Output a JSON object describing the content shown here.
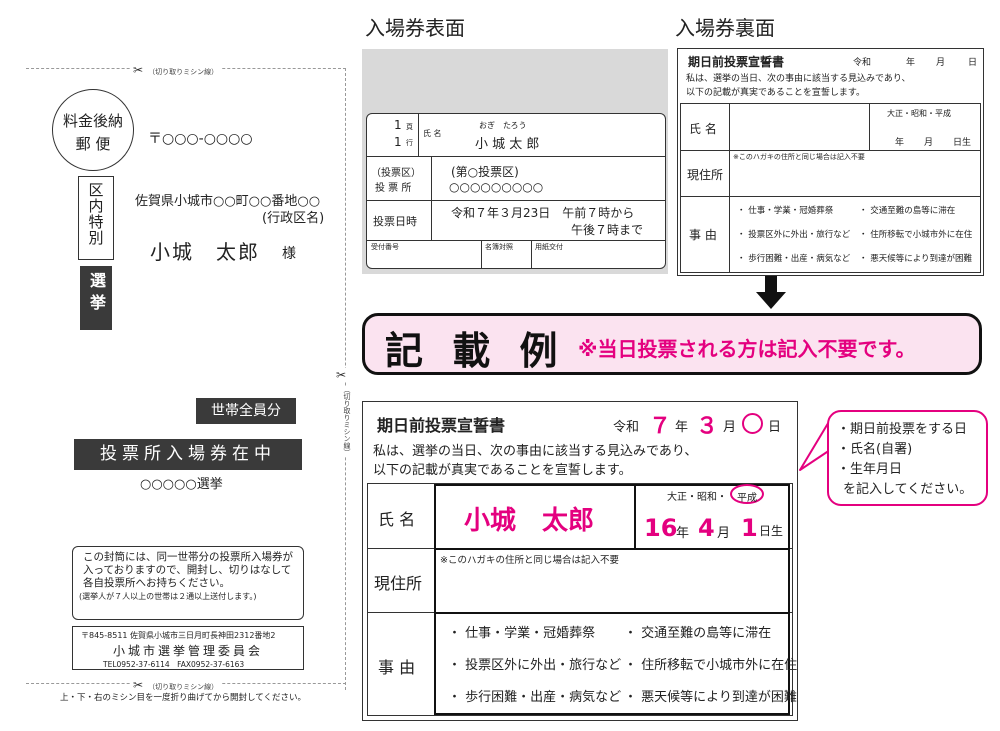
{
  "envelope": {
    "cut_line_label": "（切り取りミシン線）",
    "postage_line1": "料金後納",
    "postage_line2": "郵 便",
    "zip_code": "〒○○○-○○○○",
    "district_mark": "区内特別",
    "election_mark": "選挙",
    "address_line1": "佐賀県小城市○○町○○番地○○",
    "address_line2": "(行政区名)",
    "recipient_name": "小城　太郎",
    "honorific": "様",
    "household_label": "世帯全員分",
    "ticket_enclosed": "投票所入場券在中",
    "election_name": "○○○○○選挙",
    "notice_text": "この封筒には、同一世帯分の投票所入場券が入っておりますので、開封し、切りはなして各自投票所へお持ちください。",
    "notice_note": "(選挙人が７人以上の世帯は２通以上送付します。)",
    "sender_address": "〒845-8511 佐賀県小城市三日月町長神田2312番地2",
    "sender_name": "小城市選挙管理委員会",
    "sender_phone": "TEL0952-37-6114　FAX0952-37-6163",
    "bottom_instruction": "上・下・右のミシン目を一度折り曲げてから開封してください。"
  },
  "front": {
    "heading": "入場券表面",
    "page_num": "1",
    "page_label": "頁",
    "line_num": "1",
    "line_label": "行",
    "name_label": "氏 名",
    "furigana": "おぎ　たろう",
    "name": "小 城 太 郎",
    "district_label": "（投票区）",
    "place_label": "投 票 所",
    "district_value": "(第○投票区)",
    "place_value": "○○○○○○○○○",
    "date_label": "投票日時",
    "date_value": "令和７年３月23日　午前７時から",
    "time_value": "午後７時まで",
    "footer_col1": "受付番号",
    "footer_col2": "名簿対照",
    "footer_col3": "用紙交付"
  },
  "back": {
    "heading": "入場券裏面",
    "title": "期日前投票宣誓書",
    "era": "令和",
    "year_label": "年",
    "month_label": "月",
    "day_label": "日",
    "intro_line1": "私は、選挙の当日、次の事由に該当する見込みであり、",
    "intro_line2": "以下の記載が真実であることを宣誓します。",
    "name_label": "氏 名",
    "eras": "大正・昭和・平成",
    "birth_year": "年",
    "birth_month": "月",
    "birth_day": "日生",
    "address_label": "現住所",
    "address_note": "※このハガキの住所と同じ場合は記入不要",
    "reason_label": "事 由",
    "reasons": [
      "・ 仕事・学業・冠婚葬祭",
      "・ 交通至難の島等に滞在",
      "・ 投票区外に外出・旅行など",
      "・ 住所移転で小城市外に在住",
      "・ 歩行困難・出産・病気など",
      "・ 悪天候等により到達が困難"
    ]
  },
  "example": {
    "banner_title": "記 載 例",
    "banner_note": "※当日投票される方は記入不要です。",
    "title": "期日前投票宣誓書",
    "era": "令和",
    "year_value": "７",
    "year_label": "年",
    "month_value": "３",
    "month_label": "月",
    "day_label": "日",
    "intro_line1": "私は、選挙の当日、次の事由に該当する見込みであり、",
    "intro_line2": "以下の記載が真実であることを宣誓します。",
    "name_label": "氏 名",
    "name_value": "小城　太郎",
    "eras_prefix": "大正・昭和・",
    "era_circled": "平成",
    "birth_year_value": "16",
    "birth_year_label": "年",
    "birth_month_value": "4",
    "birth_month_label": "月",
    "birth_day_value": "1",
    "birth_day_label": "日生",
    "address_label": "現住所",
    "address_note": "※このハガキの住所と同じ場合は記入不要",
    "reason_label": "事 由",
    "reasons": [
      "・ 仕事・学業・冠婚葬祭",
      "・ 交通至難の島等に滞在",
      "・ 投票区外に外出・旅行など",
      "・ 住所移転で小城市外に在住",
      "・ 歩行困難・出産・病気など",
      "・ 悪天候等により到達が困難"
    ]
  },
  "callout": {
    "line1": "・期日前投票をする日",
    "line2": "・氏名(自署)",
    "line3": "・生年月日",
    "line4": "を記入してください。"
  },
  "colors": {
    "magenta": "#e4007f",
    "pink_bg": "#fbe3f0",
    "dark_box": "#3a3a3a",
    "gray_bg": "#d9d9d9"
  }
}
